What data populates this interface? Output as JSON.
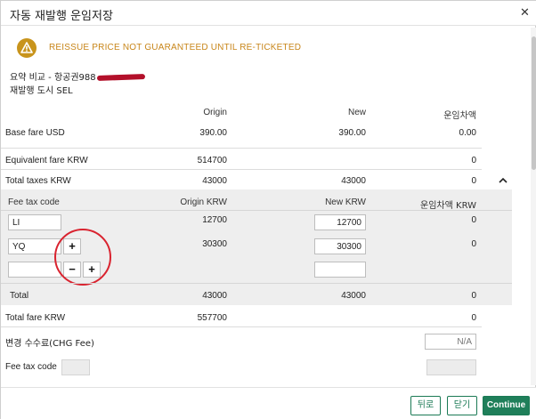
{
  "dialog": {
    "title": "자동 재발행 운임저장"
  },
  "warning": {
    "text": "REISSUE PRICE NOT GUARANTEED UNTIL RE-TICKETED"
  },
  "summary": {
    "line1": "요약 비교 - 항공권988",
    "line2": "재발행 도시 SEL"
  },
  "columns": {
    "origin": "Origin",
    "new": "New",
    "diff": "운임차액"
  },
  "rows": {
    "base_fare": {
      "label": "Base fare USD",
      "origin": "390.00",
      "new": "390.00",
      "diff": "0.00"
    },
    "equivalent_fare": {
      "label": "Equivalent fare KRW",
      "origin": "514700",
      "new": "",
      "diff": "0"
    },
    "total_taxes": {
      "label": "Total taxes KRW",
      "origin": "43000",
      "new": "43000",
      "diff": "0"
    }
  },
  "tax_table": {
    "headers": {
      "code": "Fee tax code",
      "origin": "Origin KRW",
      "new": "New KRW",
      "diff": "운임차액 KRW"
    },
    "rows": [
      {
        "code": "LI",
        "origin": "12700",
        "new": "12700",
        "diff": "0"
      },
      {
        "code": "YQ",
        "origin": "30300",
        "new": "30300",
        "diff": "0"
      },
      {
        "code": "",
        "origin": "",
        "new": "",
        "diff": ""
      }
    ],
    "total": {
      "label": "Total",
      "origin": "43000",
      "new": "43000",
      "diff": "0"
    },
    "add_symbol": "+",
    "remove_symbol": "−"
  },
  "total_fare": {
    "label": "Total fare KRW",
    "origin": "557700",
    "new": "",
    "diff": "0"
  },
  "chg_fee": {
    "label": "변경 수수료(CHG Fee)",
    "placeholder": "N/A"
  },
  "fee_tax_code": {
    "label": "Fee tax code"
  },
  "footer": {
    "back": "뒤로",
    "close": "닫기",
    "continue": "Continue"
  },
  "colors": {
    "accent": "#1f7f5a",
    "warning": "#c8941c",
    "annotation": "#d9232f"
  }
}
